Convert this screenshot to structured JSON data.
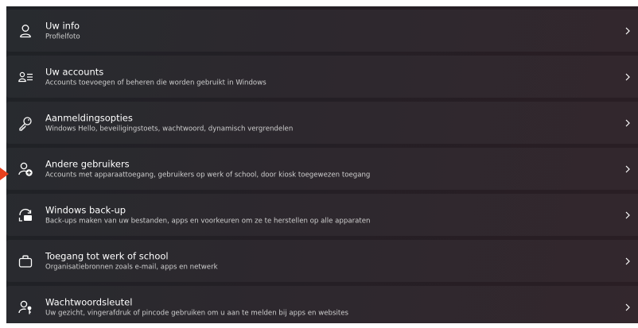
{
  "settings": {
    "items": [
      {
        "icon": "person-icon",
        "title": "Uw info",
        "subtitle": "Profielfoto"
      },
      {
        "icon": "people-list-icon",
        "title": "Uw accounts",
        "subtitle": "Accounts toevoegen of beheren die worden gebruikt in Windows"
      },
      {
        "icon": "key-icon",
        "title": "Aanmeldingsopties",
        "subtitle": "Windows Hello, beveiligingstoets, wachtwoord, dynamisch vergrendelen"
      },
      {
        "icon": "add-person-icon",
        "title": "Andere gebruikers",
        "subtitle": "Accounts met apparaattoegang, gebruikers op werk of school, door kiosk toegewezen toegang"
      },
      {
        "icon": "backup-icon",
        "title": "Windows back-up",
        "subtitle": "Back-ups maken van uw bestanden, apps en voorkeuren om ze te herstellen op alle apparaten"
      },
      {
        "icon": "briefcase-icon",
        "title": "Toegang tot werk of school",
        "subtitle": "Organisatiebronnen zoals e-mail, apps en netwerk"
      },
      {
        "icon": "passkey-icon",
        "title": "Wachtwoordsleutel",
        "subtitle": "Uw gezicht, vingerafdruk of pincode gebruiken om u aan te melden bij apps en websites"
      }
    ]
  },
  "colors": {
    "highlight_arrow": "#e8411e",
    "text_primary": "#ffffff",
    "text_secondary": "#cfcfcf"
  }
}
